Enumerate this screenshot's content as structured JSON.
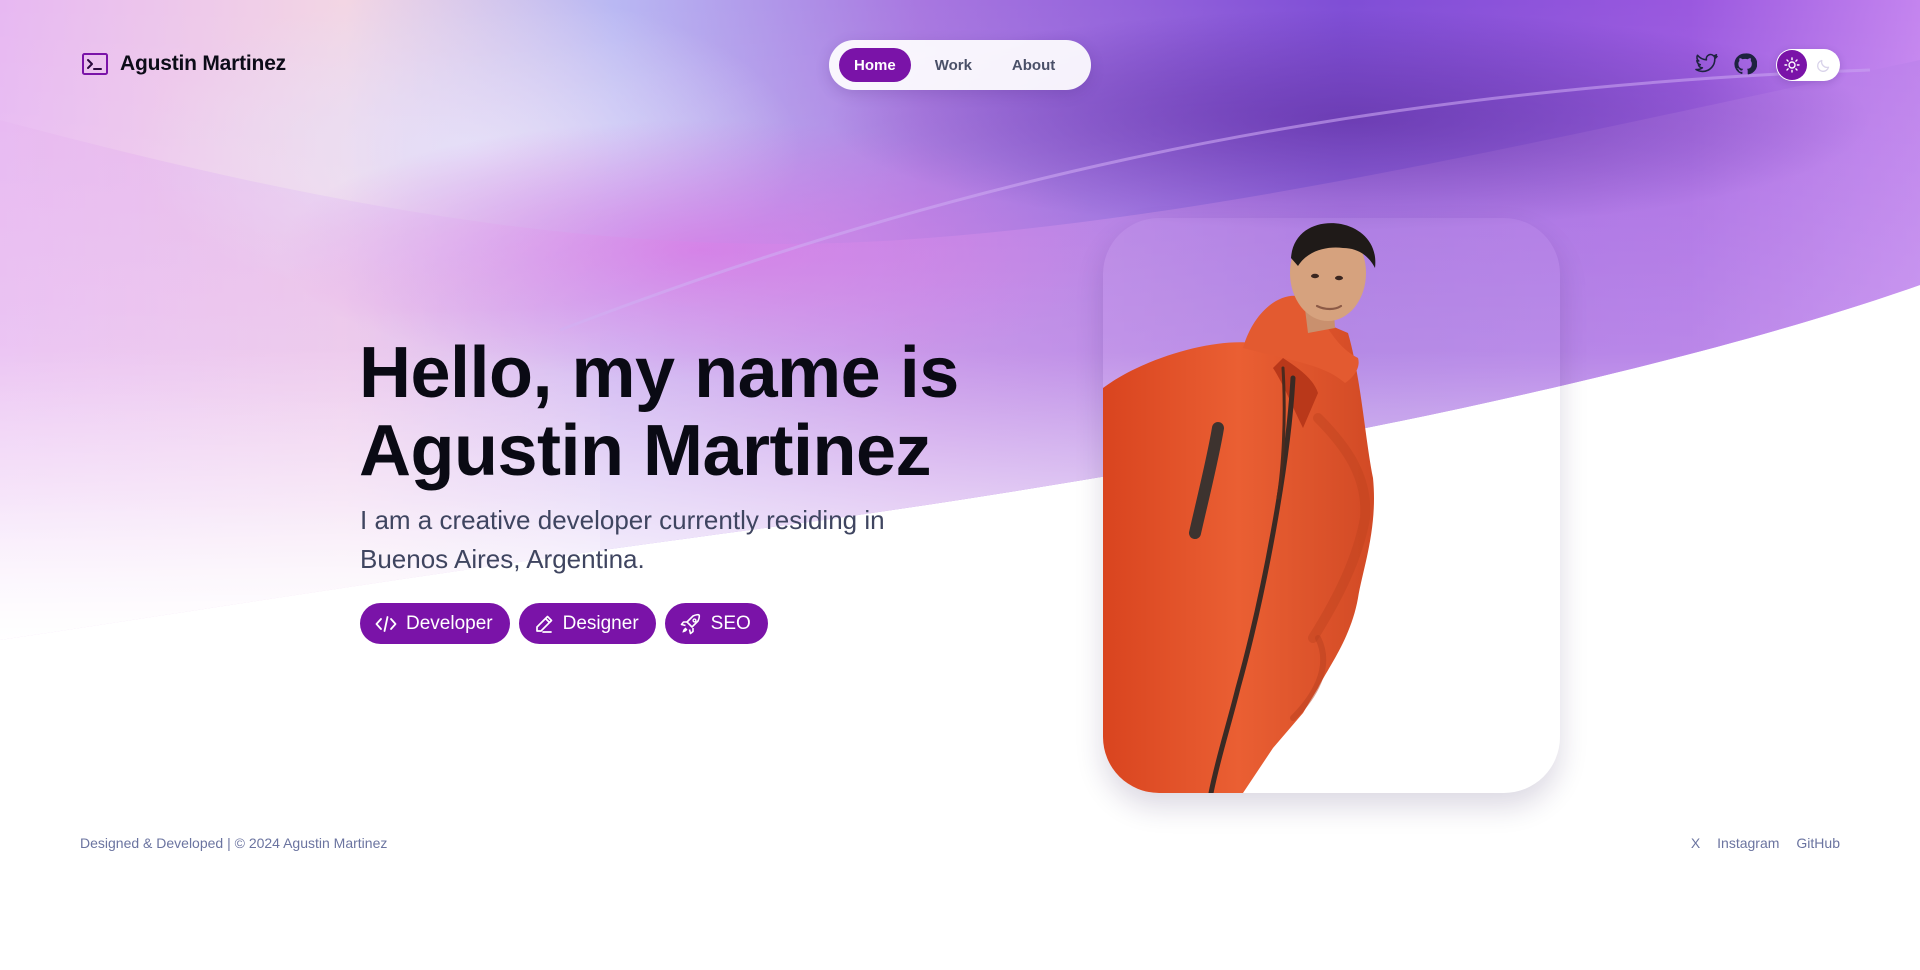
{
  "brand": {
    "name": "Agustin Martinez",
    "icon": "terminal-icon"
  },
  "nav": {
    "items": [
      {
        "label": "Home",
        "active": true
      },
      {
        "label": "Work",
        "active": false
      },
      {
        "label": "About",
        "active": false
      }
    ]
  },
  "header_icons": [
    "twitter-icon",
    "github-icon"
  ],
  "theme_toggle": {
    "mode": "light",
    "icons": [
      "sun-icon",
      "moon-icon"
    ]
  },
  "hero": {
    "title_line1": "Hello, my name is",
    "title_line2": "Agustin Martinez",
    "subtitle_line1": "I am a creative developer currently residing in",
    "subtitle_line2": "Buenos Aires, Argentina.",
    "tags": [
      {
        "label": "Developer",
        "icon": "code-icon"
      },
      {
        "label": "Designer",
        "icon": "pencil-icon"
      },
      {
        "label": "SEO",
        "icon": "rocket-icon"
      }
    ]
  },
  "footer": {
    "credit": "Designed & Developed | © 2024 Agustin Martinez",
    "links": [
      "X",
      "Instagram",
      "GitHub"
    ]
  },
  "colors": {
    "accent": "#7a13a8",
    "text_dark": "#0a0a14",
    "text_muted": "#3f4560",
    "footer_text": "#6b74a0",
    "jacket": "#e2552c"
  }
}
